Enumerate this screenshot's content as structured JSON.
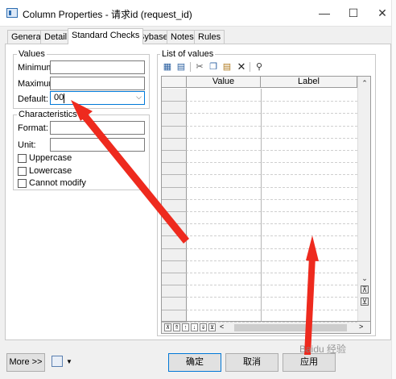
{
  "window": {
    "title": "Column Properties - 请求id (request_id)",
    "controls": [
      "—",
      "☐",
      "✕"
    ]
  },
  "tabs": [
    "General",
    "Detail",
    "Standard Checks",
    "Sybase",
    "Notes",
    "Rules"
  ],
  "active_tab": "Standard Checks",
  "values_group": {
    "title": "Values",
    "minimum_label": "Minimum:",
    "minimum_value": "",
    "maximum_label": "Maximum:",
    "maximum_value": "",
    "default_label": "Default:",
    "default_value": "00"
  },
  "characteristics_group": {
    "title": "Characteristics",
    "format_label": "Format:",
    "format_value": "",
    "unit_label": "Unit:",
    "unit_value": "",
    "uppercase_label": "Uppercase",
    "lowercase_label": "Lowercase",
    "cannot_modify_label": "Cannot modify"
  },
  "list_of_values": {
    "title": "List of values",
    "columns": [
      "Value",
      "Label"
    ],
    "toolbar_icons": [
      "add-row-icon",
      "insert-row-icon",
      "cut-icon",
      "copy-icon",
      "paste-icon",
      "delete-icon",
      "find-icon"
    ],
    "nav_icons": [
      "first-icon",
      "prev-page-icon",
      "prev-icon",
      "next-icon",
      "next-page-icon",
      "last-icon"
    ]
  },
  "buttons": {
    "more": "More >>",
    "ok": "确定",
    "cancel": "取消",
    "apply": "应用"
  },
  "watermark": "Baidu 经验"
}
